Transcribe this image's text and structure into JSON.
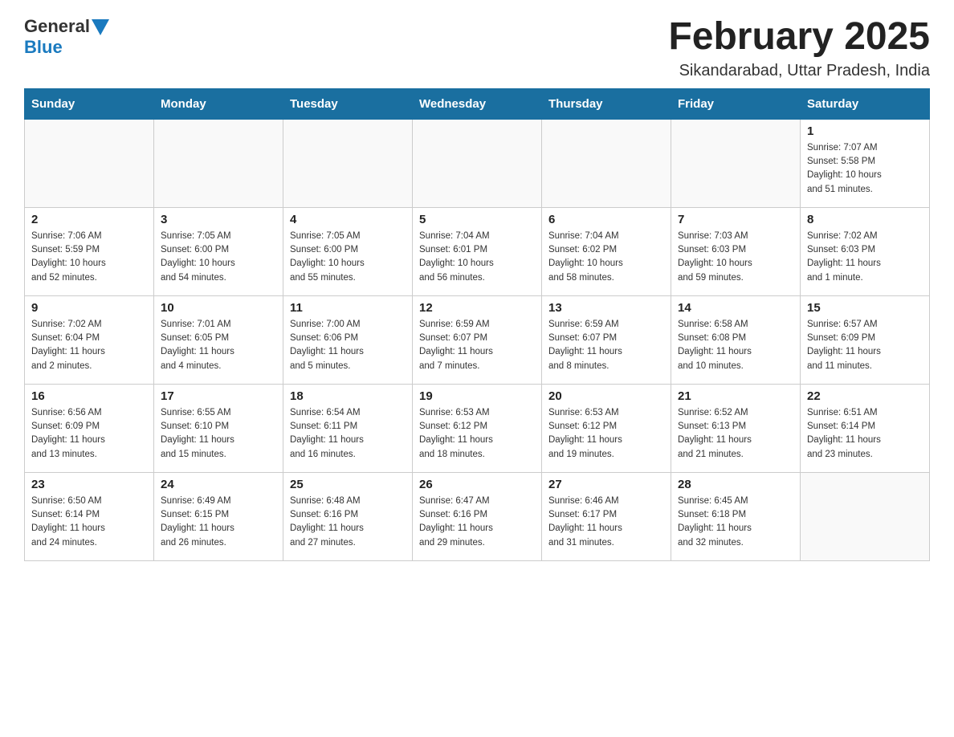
{
  "header": {
    "logo_general": "General",
    "logo_blue": "Blue",
    "month_title": "February 2025",
    "location": "Sikandarabad, Uttar Pradesh, India"
  },
  "weekdays": [
    "Sunday",
    "Monday",
    "Tuesday",
    "Wednesday",
    "Thursday",
    "Friday",
    "Saturday"
  ],
  "weeks": [
    [
      {
        "day": "",
        "info": ""
      },
      {
        "day": "",
        "info": ""
      },
      {
        "day": "",
        "info": ""
      },
      {
        "day": "",
        "info": ""
      },
      {
        "day": "",
        "info": ""
      },
      {
        "day": "",
        "info": ""
      },
      {
        "day": "1",
        "info": "Sunrise: 7:07 AM\nSunset: 5:58 PM\nDaylight: 10 hours\nand 51 minutes."
      }
    ],
    [
      {
        "day": "2",
        "info": "Sunrise: 7:06 AM\nSunset: 5:59 PM\nDaylight: 10 hours\nand 52 minutes."
      },
      {
        "day": "3",
        "info": "Sunrise: 7:05 AM\nSunset: 6:00 PM\nDaylight: 10 hours\nand 54 minutes."
      },
      {
        "day": "4",
        "info": "Sunrise: 7:05 AM\nSunset: 6:00 PM\nDaylight: 10 hours\nand 55 minutes."
      },
      {
        "day": "5",
        "info": "Sunrise: 7:04 AM\nSunset: 6:01 PM\nDaylight: 10 hours\nand 56 minutes."
      },
      {
        "day": "6",
        "info": "Sunrise: 7:04 AM\nSunset: 6:02 PM\nDaylight: 10 hours\nand 58 minutes."
      },
      {
        "day": "7",
        "info": "Sunrise: 7:03 AM\nSunset: 6:03 PM\nDaylight: 10 hours\nand 59 minutes."
      },
      {
        "day": "8",
        "info": "Sunrise: 7:02 AM\nSunset: 6:03 PM\nDaylight: 11 hours\nand 1 minute."
      }
    ],
    [
      {
        "day": "9",
        "info": "Sunrise: 7:02 AM\nSunset: 6:04 PM\nDaylight: 11 hours\nand 2 minutes."
      },
      {
        "day": "10",
        "info": "Sunrise: 7:01 AM\nSunset: 6:05 PM\nDaylight: 11 hours\nand 4 minutes."
      },
      {
        "day": "11",
        "info": "Sunrise: 7:00 AM\nSunset: 6:06 PM\nDaylight: 11 hours\nand 5 minutes."
      },
      {
        "day": "12",
        "info": "Sunrise: 6:59 AM\nSunset: 6:07 PM\nDaylight: 11 hours\nand 7 minutes."
      },
      {
        "day": "13",
        "info": "Sunrise: 6:59 AM\nSunset: 6:07 PM\nDaylight: 11 hours\nand 8 minutes."
      },
      {
        "day": "14",
        "info": "Sunrise: 6:58 AM\nSunset: 6:08 PM\nDaylight: 11 hours\nand 10 minutes."
      },
      {
        "day": "15",
        "info": "Sunrise: 6:57 AM\nSunset: 6:09 PM\nDaylight: 11 hours\nand 11 minutes."
      }
    ],
    [
      {
        "day": "16",
        "info": "Sunrise: 6:56 AM\nSunset: 6:09 PM\nDaylight: 11 hours\nand 13 minutes."
      },
      {
        "day": "17",
        "info": "Sunrise: 6:55 AM\nSunset: 6:10 PM\nDaylight: 11 hours\nand 15 minutes."
      },
      {
        "day": "18",
        "info": "Sunrise: 6:54 AM\nSunset: 6:11 PM\nDaylight: 11 hours\nand 16 minutes."
      },
      {
        "day": "19",
        "info": "Sunrise: 6:53 AM\nSunset: 6:12 PM\nDaylight: 11 hours\nand 18 minutes."
      },
      {
        "day": "20",
        "info": "Sunrise: 6:53 AM\nSunset: 6:12 PM\nDaylight: 11 hours\nand 19 minutes."
      },
      {
        "day": "21",
        "info": "Sunrise: 6:52 AM\nSunset: 6:13 PM\nDaylight: 11 hours\nand 21 minutes."
      },
      {
        "day": "22",
        "info": "Sunrise: 6:51 AM\nSunset: 6:14 PM\nDaylight: 11 hours\nand 23 minutes."
      }
    ],
    [
      {
        "day": "23",
        "info": "Sunrise: 6:50 AM\nSunset: 6:14 PM\nDaylight: 11 hours\nand 24 minutes."
      },
      {
        "day": "24",
        "info": "Sunrise: 6:49 AM\nSunset: 6:15 PM\nDaylight: 11 hours\nand 26 minutes."
      },
      {
        "day": "25",
        "info": "Sunrise: 6:48 AM\nSunset: 6:16 PM\nDaylight: 11 hours\nand 27 minutes."
      },
      {
        "day": "26",
        "info": "Sunrise: 6:47 AM\nSunset: 6:16 PM\nDaylight: 11 hours\nand 29 minutes."
      },
      {
        "day": "27",
        "info": "Sunrise: 6:46 AM\nSunset: 6:17 PM\nDaylight: 11 hours\nand 31 minutes."
      },
      {
        "day": "28",
        "info": "Sunrise: 6:45 AM\nSunset: 6:18 PM\nDaylight: 11 hours\nand 32 minutes."
      },
      {
        "day": "",
        "info": ""
      }
    ]
  ]
}
